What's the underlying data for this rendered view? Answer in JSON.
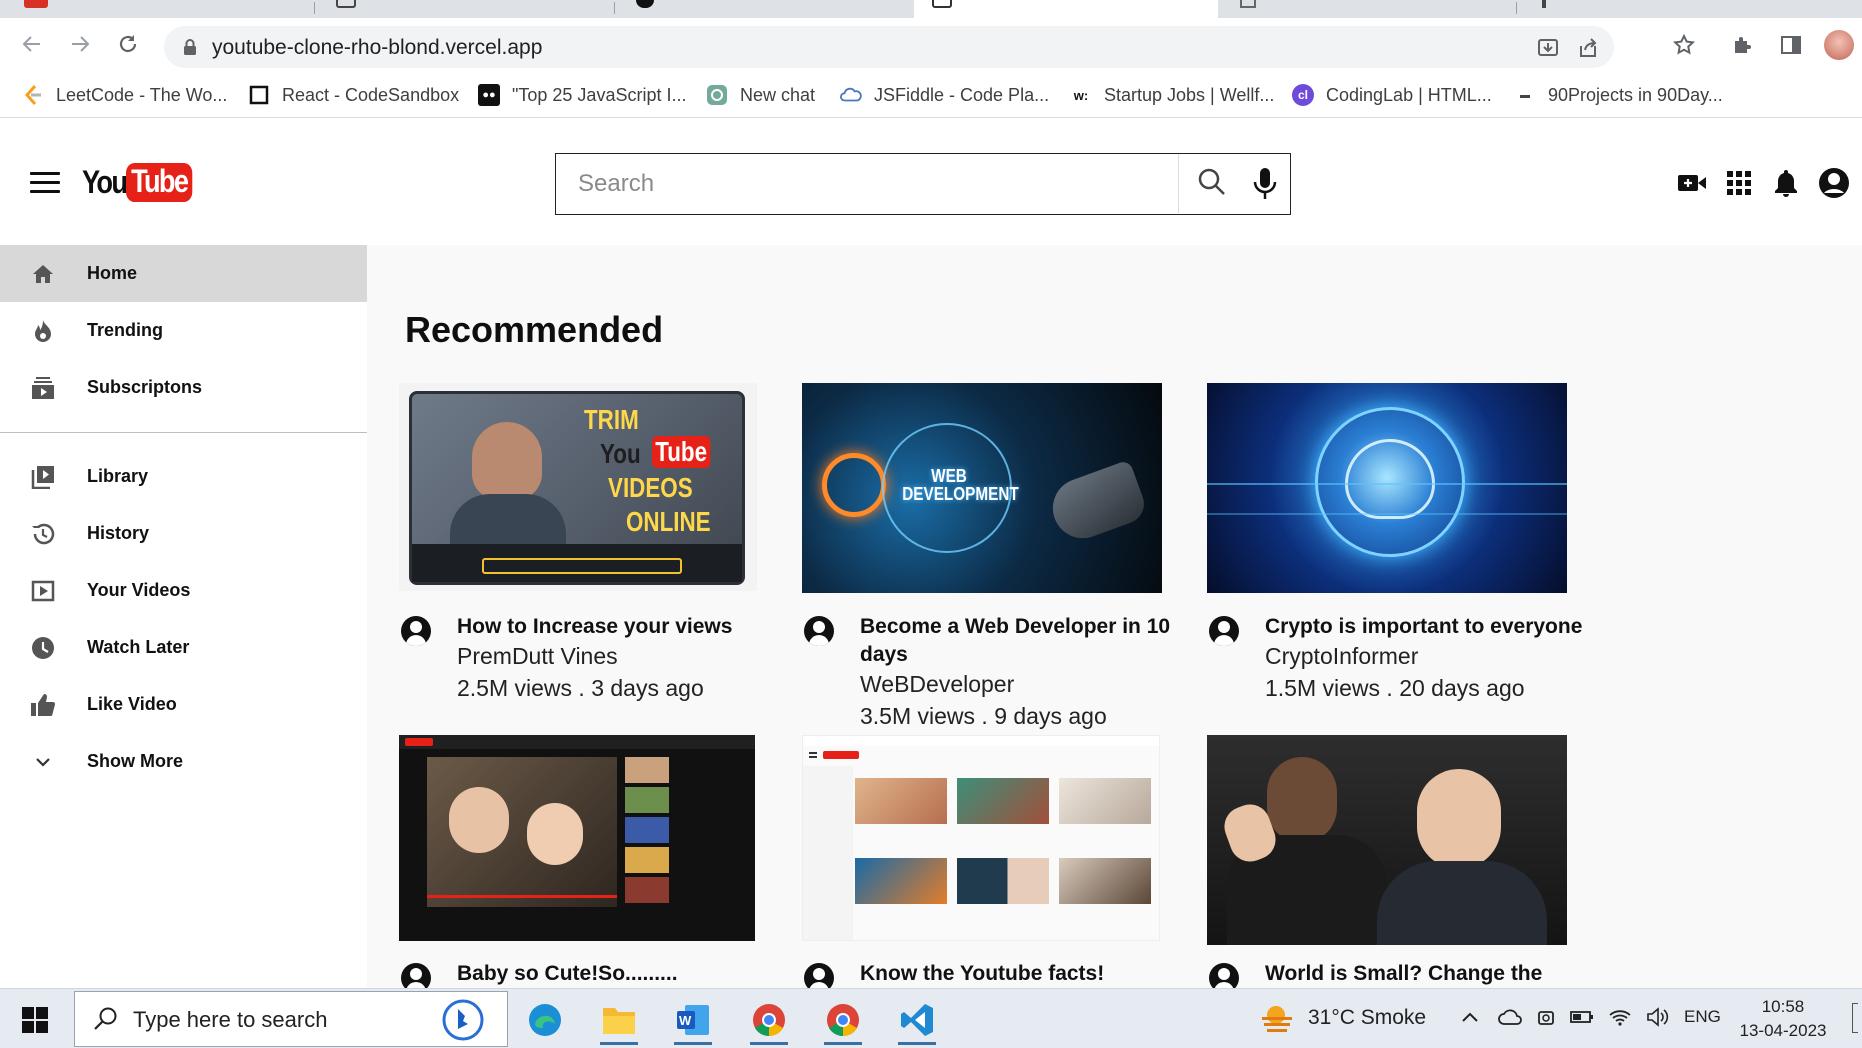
{
  "browser": {
    "url": "youtube-clone-rho-blond.vercel.app",
    "bookmarks": [
      {
        "label": "LeetCode - The Wo...",
        "icon": "leetcode-icon"
      },
      {
        "label": "React - CodeSandbox",
        "icon": "codesandbox-icon"
      },
      {
        "label": "\"Top 25 JavaScript I...",
        "icon": "dev-icon"
      },
      {
        "label": "New chat",
        "icon": "openai-icon"
      },
      {
        "label": "JSFiddle - Code Pla...",
        "icon": "jsfiddle-icon"
      },
      {
        "label": "Startup Jobs | Wellf...",
        "icon": "wellfound-icon"
      },
      {
        "label": "CodingLab | HTML...",
        "icon": "codinglab-icon"
      },
      {
        "label": "90Projects in 90Day...",
        "icon": "page-icon"
      }
    ]
  },
  "header": {
    "logo_you": "You",
    "logo_tube": "Tube",
    "search_placeholder": "Search"
  },
  "sidebar": {
    "items": [
      {
        "label": "Home",
        "icon": "home-icon"
      },
      {
        "label": "Trending",
        "icon": "fire-icon"
      },
      {
        "label": "Subscriptons",
        "icon": "subscriptions-icon"
      },
      {
        "label": "Library",
        "icon": "library-icon"
      },
      {
        "label": "History",
        "icon": "history-icon"
      },
      {
        "label": "Your Videos",
        "icon": "your-videos-icon"
      },
      {
        "label": "Watch Later",
        "icon": "clock-icon"
      },
      {
        "label": "Like Video",
        "icon": "thumbs-up-icon"
      },
      {
        "label": "Show More",
        "icon": "chevron-down-icon"
      }
    ]
  },
  "main": {
    "title": "Recommended",
    "videos": [
      {
        "title": "How to Increase your views",
        "channel": "PremDutt Vines",
        "meta": "2.5M views . 3 days ago",
        "thumb_text": [
          "TRIM",
          "You",
          "Tube",
          "VIDEOS",
          "ONLINE"
        ]
      },
      {
        "title": "Become a Web Developer in 10 days",
        "channel": "WeBDeveloper",
        "meta": "3.5M views . 9 days ago",
        "thumb_text": [
          "WEB",
          "DEVELOPMENT"
        ]
      },
      {
        "title": "Crypto is important to everyone",
        "channel": "CryptoInformer",
        "meta": "1.5M views . 20 days ago"
      },
      {
        "title": "Baby so Cute!So.........",
        "channel": "",
        "meta": ""
      },
      {
        "title": "Know the Youtube facts! ..Really",
        "channel": "",
        "meta": ""
      },
      {
        "title": "World is Small? Change the",
        "channel": "",
        "meta": ""
      }
    ]
  },
  "taskbar": {
    "search_placeholder": "Type here to search",
    "weather": "31°C  Smoke",
    "language": "ENG",
    "time": "10:58",
    "date": "13-04-2023"
  }
}
